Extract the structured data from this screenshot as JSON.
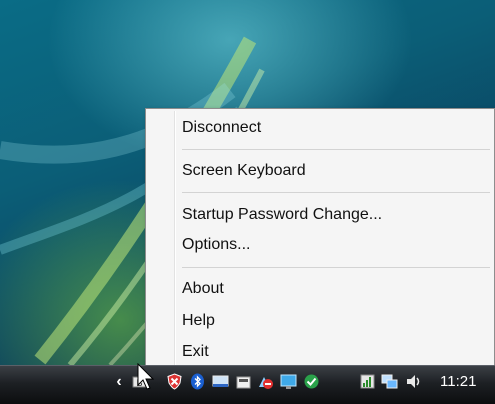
{
  "context_menu": {
    "items": [
      {
        "label": "Disconnect"
      },
      {
        "label": "Screen Keyboard"
      },
      {
        "label": "Startup Password Change..."
      },
      {
        "label": "Options..."
      },
      {
        "label": "About"
      },
      {
        "label": "Help"
      },
      {
        "label": "Exit"
      }
    ]
  },
  "taskbar": {
    "clock": "11:21",
    "show_hidden_icon": "chevron-left-icon",
    "tray_icons": [
      "network-app-icon",
      "security-shield-icon",
      "bluetooth-icon",
      "display-icon",
      "device-icon",
      "disconnect-icon",
      "monitor-icon",
      "check-icon",
      "wireless-signal-icon",
      "network-computers-icon",
      "volume-icon"
    ]
  }
}
